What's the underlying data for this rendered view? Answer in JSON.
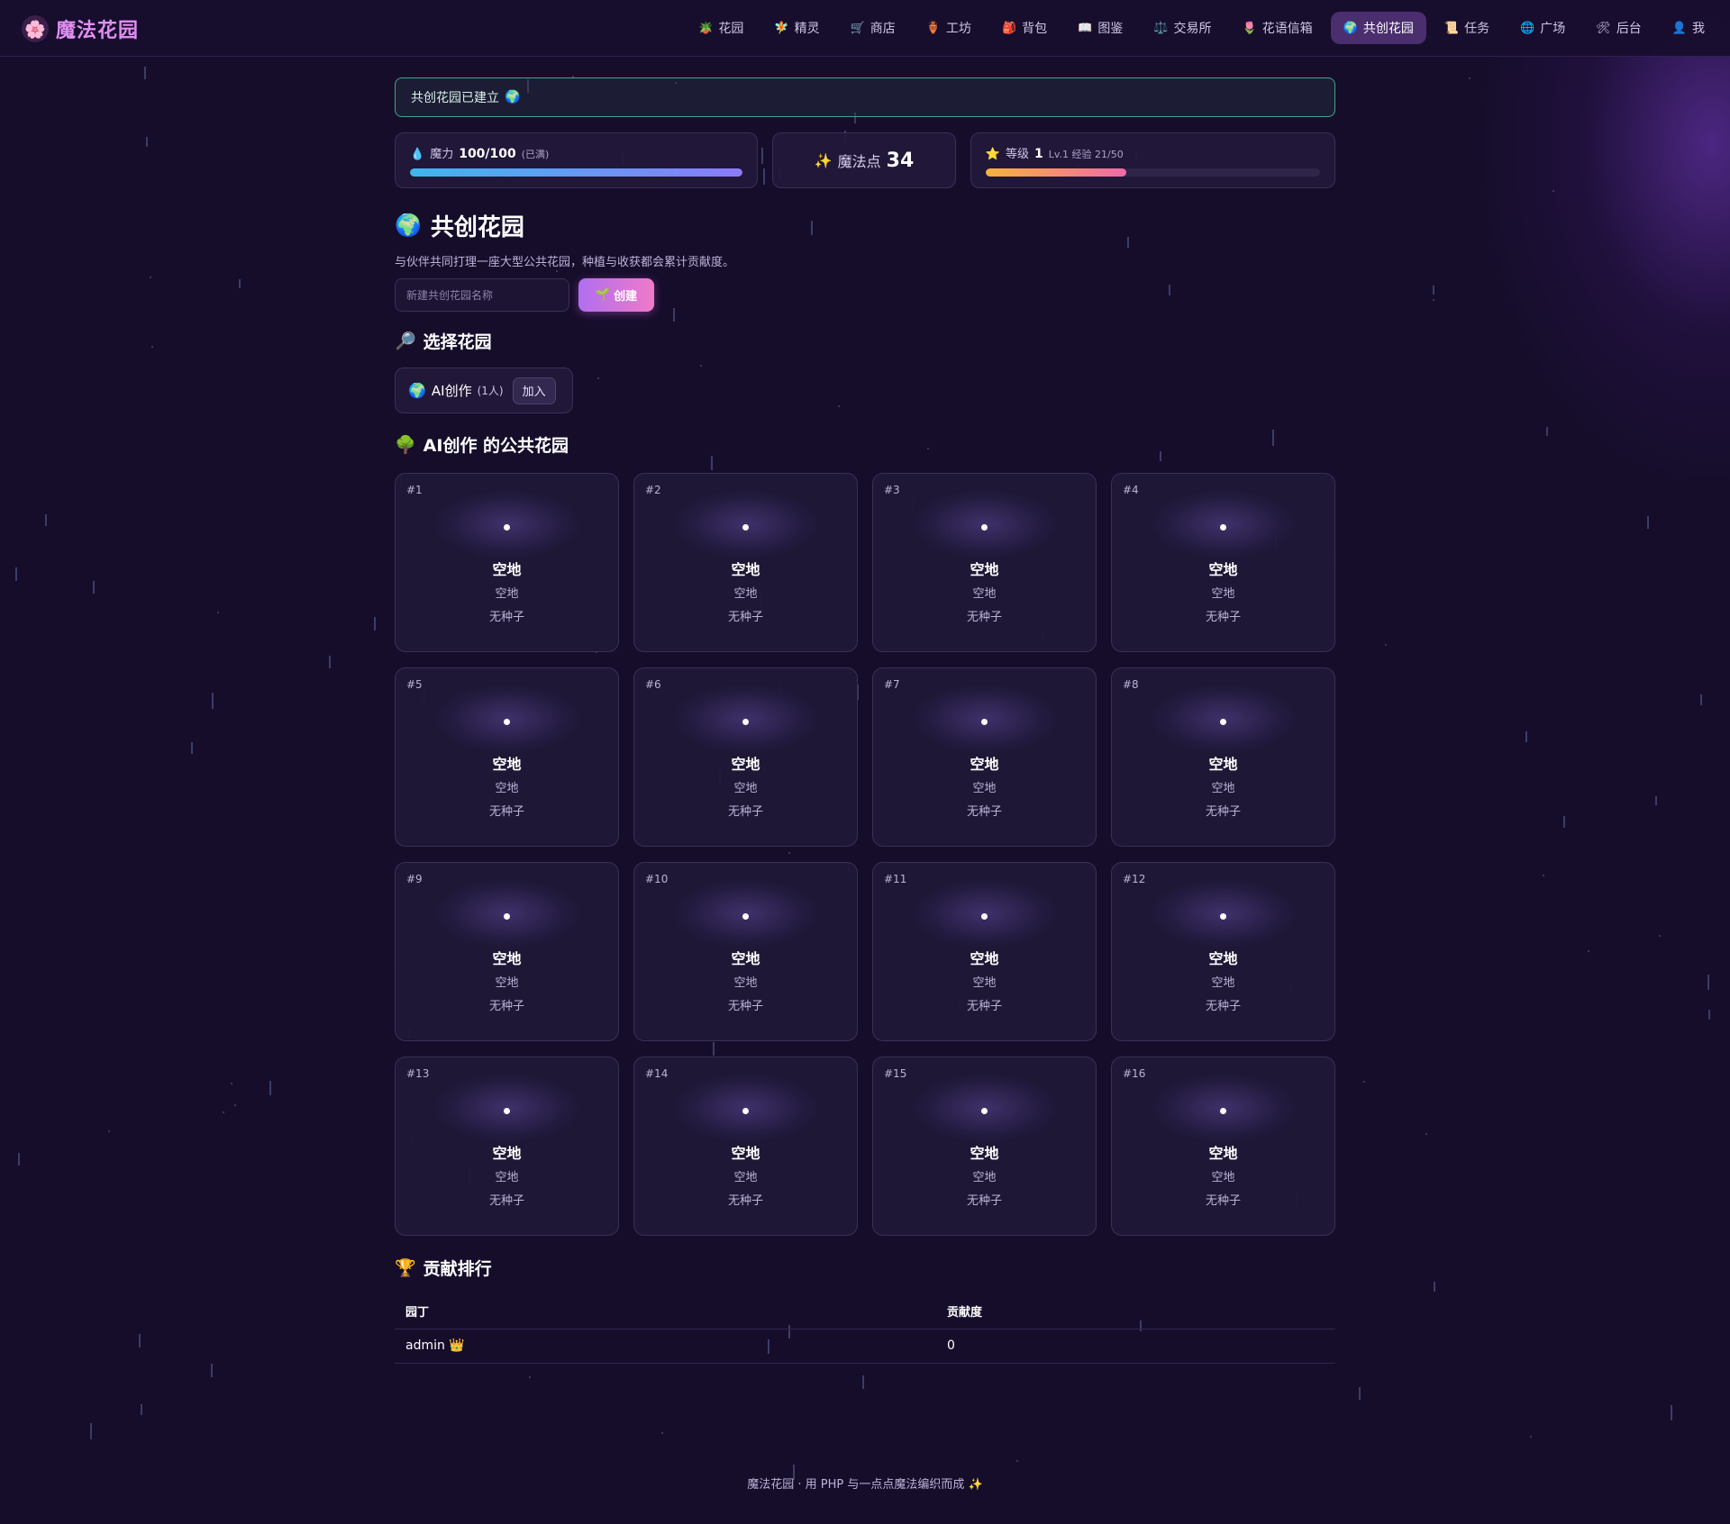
{
  "brand": {
    "logo": "🌸",
    "name": "魔法花园"
  },
  "nav": [
    {
      "icon": "🪴",
      "label": "花园"
    },
    {
      "icon": "🧚",
      "label": "精灵"
    },
    {
      "icon": "🛒",
      "label": "商店"
    },
    {
      "icon": "🏺",
      "label": "工坊"
    },
    {
      "icon": "🎒",
      "label": "背包"
    },
    {
      "icon": "📖",
      "label": "图鉴"
    },
    {
      "icon": "⚖️",
      "label": "交易所"
    },
    {
      "icon": "🌷",
      "label": "花语信箱"
    },
    {
      "icon": "🌍",
      "label": "共创花园",
      "active": true
    },
    {
      "icon": "📜",
      "label": "任务"
    },
    {
      "icon": "🌐",
      "label": "广场"
    },
    {
      "icon": "🛠",
      "label": "后台"
    },
    {
      "icon": "👤",
      "label": "我"
    }
  ],
  "notice": {
    "text": "共创花园已建立",
    "icon": "🌍"
  },
  "stats": {
    "mana": {
      "icon": "💧",
      "label": "魔力",
      "value": "100/100",
      "note": "(已满)",
      "fill": 1.0
    },
    "points": {
      "icon": "✨",
      "label": "魔法点",
      "value": "34"
    },
    "level": {
      "icon": "⭐",
      "label": "等级",
      "value": "1",
      "detail": "Lv.1 经验 21/50",
      "fill": 0.42
    }
  },
  "page": {
    "icon": "🌍",
    "title": "共创花园",
    "description": "与伙伴共同打理一座大型公共花园，种植与收获都会累计贡献度。",
    "create_placeholder": "新建共创花园名称",
    "create_button_icon": "🌱",
    "create_button": "创建"
  },
  "select_section": {
    "icon": "🔎",
    "title": "选择花园",
    "garden": {
      "icon": "🌍",
      "name": "AI创作",
      "members": "(1人)",
      "join_label": "加入"
    }
  },
  "public_section": {
    "icon": "🌳",
    "title": "AI创作 的公共花园",
    "plots": [
      {
        "num": "#1",
        "status": "空地",
        "sub": "空地",
        "seed": "无种子"
      },
      {
        "num": "#2",
        "status": "空地",
        "sub": "空地",
        "seed": "无种子"
      },
      {
        "num": "#3",
        "status": "空地",
        "sub": "空地",
        "seed": "无种子"
      },
      {
        "num": "#4",
        "status": "空地",
        "sub": "空地",
        "seed": "无种子"
      },
      {
        "num": "#5",
        "status": "空地",
        "sub": "空地",
        "seed": "无种子"
      },
      {
        "num": "#6",
        "status": "空地",
        "sub": "空地",
        "seed": "无种子"
      },
      {
        "num": "#7",
        "status": "空地",
        "sub": "空地",
        "seed": "无种子"
      },
      {
        "num": "#8",
        "status": "空地",
        "sub": "空地",
        "seed": "无种子"
      },
      {
        "num": "#9",
        "status": "空地",
        "sub": "空地",
        "seed": "无种子"
      },
      {
        "num": "#10",
        "status": "空地",
        "sub": "空地",
        "seed": "无种子"
      },
      {
        "num": "#11",
        "status": "空地",
        "sub": "空地",
        "seed": "无种子"
      },
      {
        "num": "#12",
        "status": "空地",
        "sub": "空地",
        "seed": "无种子"
      },
      {
        "num": "#13",
        "status": "空地",
        "sub": "空地",
        "seed": "无种子"
      },
      {
        "num": "#14",
        "status": "空地",
        "sub": "空地",
        "seed": "无种子"
      },
      {
        "num": "#15",
        "status": "空地",
        "sub": "空地",
        "seed": "无种子"
      },
      {
        "num": "#16",
        "status": "空地",
        "sub": "空地",
        "seed": "无种子"
      }
    ]
  },
  "ranking": {
    "icon": "🏆",
    "title": "贡献排行",
    "headers": {
      "user": "园丁",
      "score": "贡献度"
    },
    "rows": [
      {
        "user": "admin",
        "badge": "👑",
        "score": "0"
      }
    ]
  },
  "footer": {
    "text": "魔法花园 · 用 PHP 与一点点魔法编织而成 ✨"
  },
  "colors": {
    "background": "#160d2b",
    "accent": "#e08ff0",
    "notice_border": "#3fa58a",
    "active_nav": "#4a2e6e"
  }
}
